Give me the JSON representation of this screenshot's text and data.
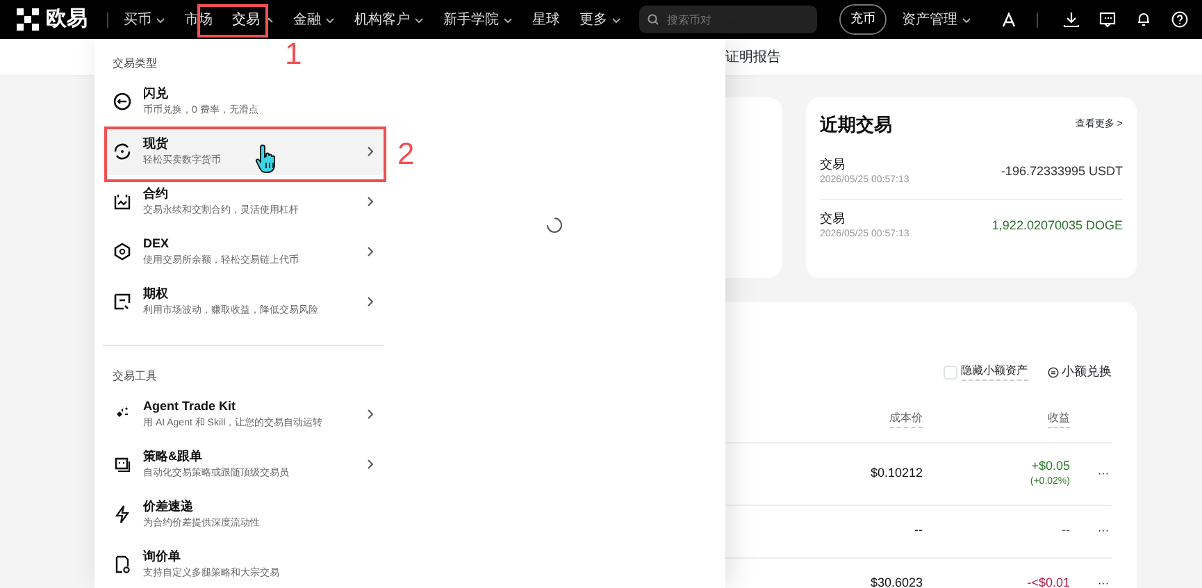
{
  "navbar": {
    "logo": "欧易",
    "items": [
      {
        "label": "买币",
        "caret": true,
        "expanded": false
      },
      {
        "label": "市场",
        "caret": false,
        "expanded": false
      },
      {
        "label": "交易",
        "caret": true,
        "expanded": true
      },
      {
        "label": "金融",
        "caret": true,
        "expanded": false
      },
      {
        "label": "机构客户",
        "caret": true,
        "expanded": false
      },
      {
        "label": "新手学院",
        "caret": true,
        "expanded": false
      },
      {
        "label": "星球",
        "caret": false,
        "expanded": false
      },
      {
        "label": "更多",
        "caret": true,
        "expanded": false
      }
    ],
    "search": {
      "placeholder": "搜索币对"
    },
    "deposit": "充币",
    "assets_menu": "资产管理"
  },
  "subbar": {
    "link": "证明报告"
  },
  "dropdown": {
    "sections": [
      {
        "title": "交易类型",
        "items": [
          {
            "title": "闪兑",
            "desc": "币币兑换，0 费率，无滑点",
            "arrow": false,
            "selected": false
          },
          {
            "title": "现货",
            "desc": "轻松买卖数字货币",
            "arrow": true,
            "selected": true
          },
          {
            "title": "合约",
            "desc": "交易永续和交割合约，灵活使用杠杆",
            "arrow": true,
            "selected": false
          },
          {
            "title": "DEX",
            "desc": "使用交易所余额，轻松交易链上代币",
            "arrow": true,
            "selected": false
          },
          {
            "title": "期权",
            "desc": "利用市场波动，赚取收益，降低交易风险",
            "arrow": true,
            "selected": false
          }
        ]
      },
      {
        "title": "交易工具",
        "items": [
          {
            "title": "Agent Trade Kit",
            "desc": "用 AI Agent 和 Skill，让您的交易自动运转",
            "arrow": true,
            "selected": false
          },
          {
            "title": "策略&跟单",
            "desc": "自动化交易策略或跟随顶级交易员",
            "arrow": true,
            "selected": false
          },
          {
            "title": "价差速递",
            "desc": "为合约价差提供深度流动性",
            "arrow": false,
            "selected": false
          },
          {
            "title": "询价单",
            "desc": "支持自定义多腿策略和大宗交易",
            "arrow": false,
            "selected": false
          }
        ]
      }
    ],
    "loading": true
  },
  "recent_trades": {
    "title": "近期交易",
    "more": "查看更多 >",
    "rows": [
      {
        "type": "交易",
        "time": "2026/05/25 00:57:13",
        "amount": "-196.72333995 USDT",
        "color": "#333333"
      },
      {
        "type": "交易",
        "time": "2026/05/25 00:57:13",
        "amount": "1,922.02070035 DOGE",
        "color": "#2a6e2a"
      }
    ]
  },
  "holdings": {
    "hide_small": {
      "label": "隐藏小额资产",
      "checked": false
    },
    "convert": "小额兑换",
    "columns": [
      "成本价",
      "收益"
    ],
    "rows": [
      {
        "cost": "$0.10212",
        "pnl": "+$0.05",
        "pct": "(+0.02%)",
        "color": "#2a7a2a",
        "actions": "···"
      },
      {
        "cost": "--",
        "pnl": "--",
        "color": "#555555",
        "actions": "···"
      },
      {
        "cost": "$30.6023",
        "pnl": "-<$0.01",
        "color": "#b0204a",
        "actions": "···"
      }
    ]
  },
  "annotations": [
    {
      "number": "1"
    },
    {
      "number": "2"
    }
  ]
}
